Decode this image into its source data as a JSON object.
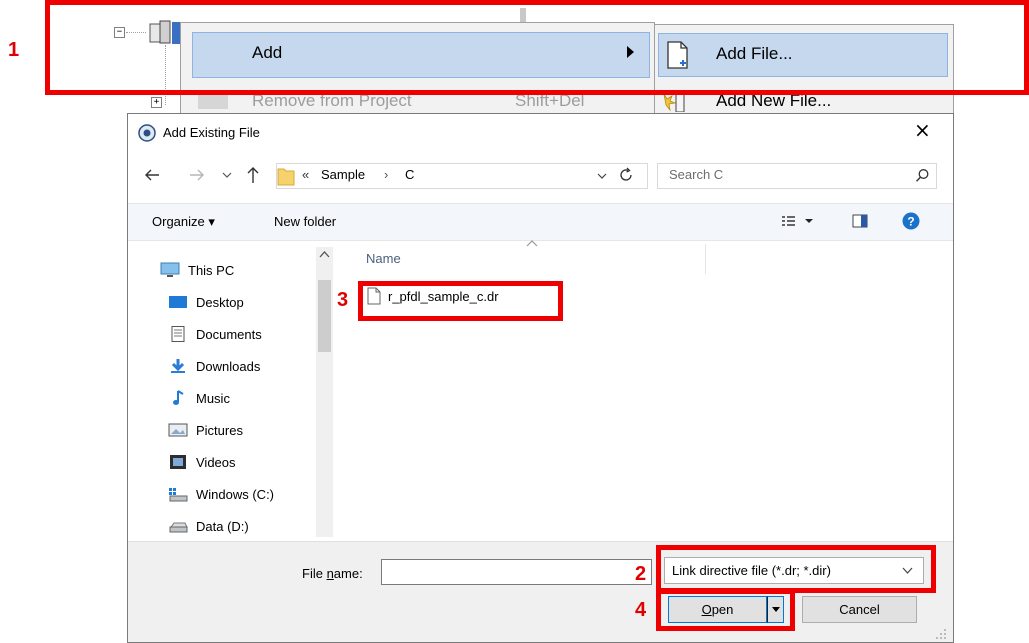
{
  "context_menu": {
    "add_label": "Add",
    "remove_label": "Remove from Project",
    "remove_shortcut": "Shift+Del"
  },
  "submenu": {
    "add_file_label": "Add File...",
    "add_new_file_label": "Add New File..."
  },
  "callouts": {
    "one": "1",
    "two": "2",
    "three": "3",
    "four": "4"
  },
  "dialog": {
    "title": "Add Existing File",
    "close_glyph": "×",
    "breadcrumb": {
      "overflow": "«",
      "parts": [
        "Sample",
        "C"
      ],
      "sep": "›"
    },
    "search_placeholder": "Search C",
    "toolbar": {
      "organize": "Organize ▾",
      "new_folder": "New folder"
    },
    "nav_items": [
      {
        "label": "This PC",
        "icon": "computer-icon"
      },
      {
        "label": "Desktop",
        "icon": "desktop-icon"
      },
      {
        "label": "Documents",
        "icon": "documents-icon"
      },
      {
        "label": "Downloads",
        "icon": "downloads-icon"
      },
      {
        "label": "Music",
        "icon": "music-icon"
      },
      {
        "label": "Pictures",
        "icon": "pictures-icon"
      },
      {
        "label": "Videos",
        "icon": "videos-icon"
      },
      {
        "label": "Windows (C:)",
        "icon": "drive-windows-icon"
      },
      {
        "label": "Data (D:)",
        "icon": "drive-icon"
      }
    ],
    "column_header": "Name",
    "files": [
      {
        "name": "r_pfdl_sample_c.dr",
        "icon": "file-icon"
      }
    ],
    "footer": {
      "file_name_label_pre": "File ",
      "file_name_label_mnemonic": "n",
      "file_name_label_post": "ame:",
      "file_name_value": "",
      "filter_value": "Link directive file (*.dr; *.dir)",
      "open_mnemonic": "O",
      "open_rest": "pen",
      "cancel_label": "Cancel"
    }
  },
  "colors": {
    "callout_red": "#ee0000",
    "menu_highlight": "#c5d8ee",
    "help_blue": "#1a73c8"
  }
}
